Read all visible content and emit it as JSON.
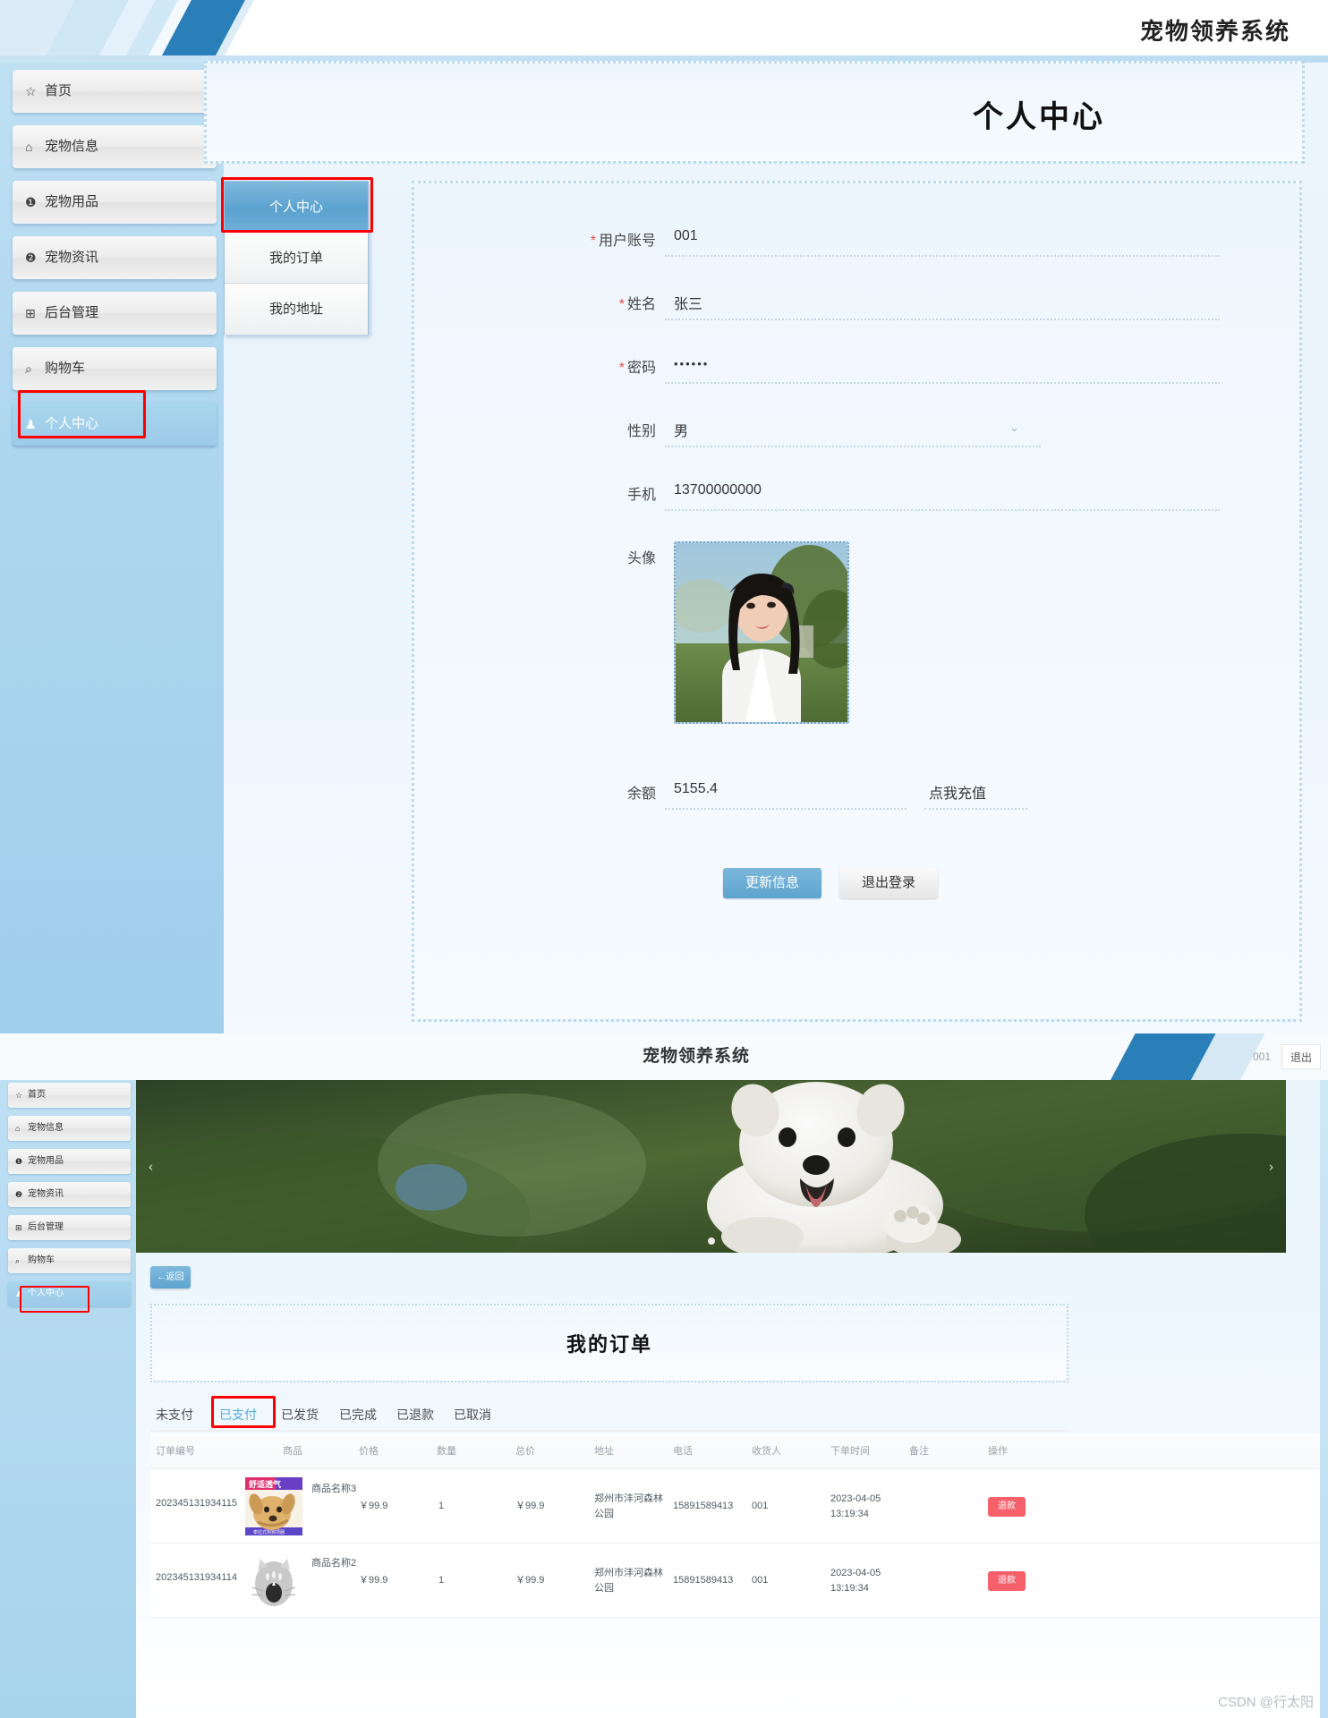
{
  "shot1": {
    "banner": {
      "title": "宠物领养系统"
    },
    "sidebar": {
      "items": [
        {
          "label": "首页",
          "icon": "star-icon",
          "glyph": "☆",
          "active": false
        },
        {
          "label": "宠物信息",
          "icon": "bag-icon",
          "glyph": "⌂",
          "active": false
        },
        {
          "label": "宠物用品",
          "icon": "exclamation-icon",
          "glyph": "❶",
          "active": false
        },
        {
          "label": "宠物资讯",
          "icon": "question-icon",
          "glyph": "❷",
          "active": false
        },
        {
          "label": "后台管理",
          "icon": "briefcase-icon",
          "glyph": "⊞",
          "active": false
        },
        {
          "label": "购物车",
          "icon": "cart-icon",
          "glyph": "🛒",
          "active": false
        },
        {
          "label": "个人中心",
          "icon": "user-icon",
          "glyph": "👤",
          "active": true
        }
      ]
    },
    "page_title": "个人中心",
    "tabs": [
      {
        "label": "个人中心",
        "selected": true
      },
      {
        "label": "我的订单",
        "selected": false
      },
      {
        "label": "我的地址",
        "selected": false
      }
    ],
    "form": {
      "account": {
        "label": "用户账号",
        "value": "001",
        "required": true
      },
      "name": {
        "label": "姓名",
        "value": "张三",
        "required": true
      },
      "password": {
        "label": "密码",
        "value": "••••••",
        "required": true
      },
      "gender": {
        "label": "性别",
        "value": "男",
        "required": false,
        "caret": "⌄"
      },
      "phone": {
        "label": "手机",
        "value": "13700000000",
        "required": false
      },
      "avatar": {
        "label": "头像"
      },
      "balance": {
        "label": "余额",
        "value": "5155.4"
      },
      "recharge_link": "点我充值"
    },
    "buttons": {
      "update": "更新信息",
      "logout": "退出登录"
    }
  },
  "shot2": {
    "banner": {
      "title": "宠物领养系统",
      "user": "001",
      "logout": "退出"
    },
    "sidebar": {
      "items": [
        {
          "label": "首页",
          "icon": "star-icon",
          "glyph": "☆",
          "active": false
        },
        {
          "label": "宠物信息",
          "icon": "bag-icon",
          "glyph": "⌂",
          "active": false
        },
        {
          "label": "宠物用品",
          "icon": "exclamation-icon",
          "glyph": "❶",
          "active": false
        },
        {
          "label": "宠物资讯",
          "icon": "question-icon",
          "glyph": "❷",
          "active": false
        },
        {
          "label": "后台管理",
          "icon": "briefcase-icon",
          "glyph": "⊞",
          "active": false
        },
        {
          "label": "购物车",
          "icon": "cart-icon",
          "glyph": "🛒",
          "active": false
        },
        {
          "label": "个人中心",
          "icon": "user-icon",
          "glyph": "👤",
          "active": true
        }
      ]
    },
    "carousel": {
      "prev": "‹",
      "next": "›"
    },
    "back_button": "←返回",
    "orders_title": "我的订单",
    "order_tabs": [
      {
        "label": "未支付",
        "selected": false
      },
      {
        "label": "已支付",
        "selected": true
      },
      {
        "label": "已发货",
        "selected": false
      },
      {
        "label": "已完成",
        "selected": false
      },
      {
        "label": "已退款",
        "selected": false
      },
      {
        "label": "已取消",
        "selected": false
      }
    ],
    "table": {
      "columns": [
        "订单编号",
        "商品",
        "价格",
        "数量",
        "总价",
        "地址",
        "电话",
        "收货人",
        "下单时间",
        "备注",
        "操作"
      ],
      "rows": [
        {
          "order_no": "202345131934115",
          "product": "商品名称3",
          "price": "￥99.9",
          "qty": "1",
          "total": "￥99.9",
          "address": "郑州市沣河森林公园",
          "phone": "15891589413",
          "receiver": "001",
          "order_time": "2023-04-05 13:19:34",
          "remark": "",
          "action": "退款"
        },
        {
          "order_no": "202345131934114",
          "product": "商品名称2",
          "price": "￥99.9",
          "qty": "1",
          "total": "￥99.9",
          "address": "郑州市沣河森林公园",
          "phone": "15891589413",
          "receiver": "001",
          "order_time": "2023-04-05 13:19:34",
          "remark": "",
          "action": "退款"
        }
      ]
    },
    "watermark": "CSDN @行太阳"
  }
}
